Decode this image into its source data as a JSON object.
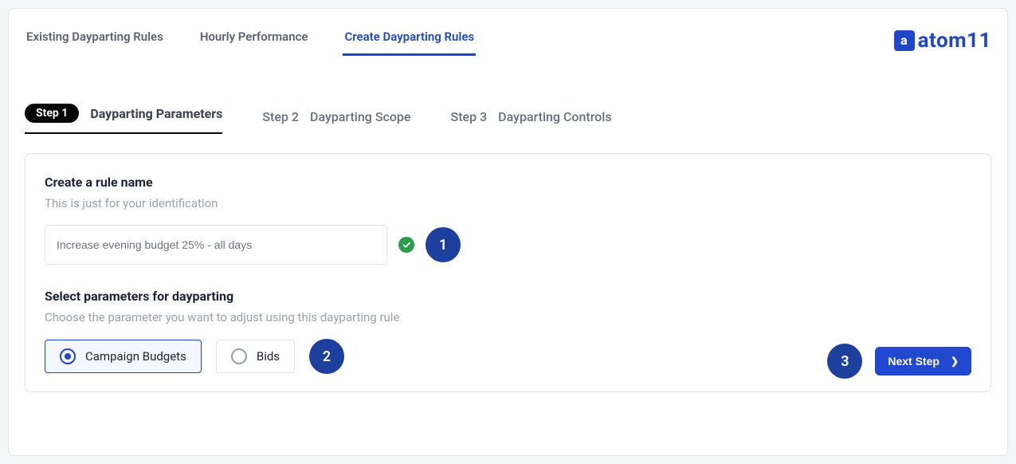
{
  "brand": {
    "name": "atom11",
    "icon_letter": "a"
  },
  "toptabs": [
    {
      "label": "Existing Dayparting Rules",
      "active": false
    },
    {
      "label": "Hourly Performance",
      "active": false
    },
    {
      "label": "Create Dayparting Rules",
      "active": true
    }
  ],
  "steps": [
    {
      "pill": "Step 1",
      "label": "Dayparting Parameters",
      "active": true
    },
    {
      "pill": "Step 2",
      "label": "Dayparting Scope",
      "active": false
    },
    {
      "pill": "Step 3",
      "label": "Dayparting Controls",
      "active": false
    }
  ],
  "form": {
    "rule_name": {
      "title": "Create a rule name",
      "subtitle": "This is just for your identification",
      "value": "Increase evening budget 25% - all days",
      "valid": true,
      "callout": "1"
    },
    "params": {
      "title": "Select parameters for dayparting",
      "subtitle": "Choose the parameter you want to adjust using this dayparting rule",
      "choices": [
        {
          "label": "Campaign Budgets",
          "selected": true
        },
        {
          "label": "Bids",
          "selected": false
        }
      ],
      "callout": "2"
    }
  },
  "footer": {
    "callout": "3",
    "next_label": "Next Step"
  }
}
